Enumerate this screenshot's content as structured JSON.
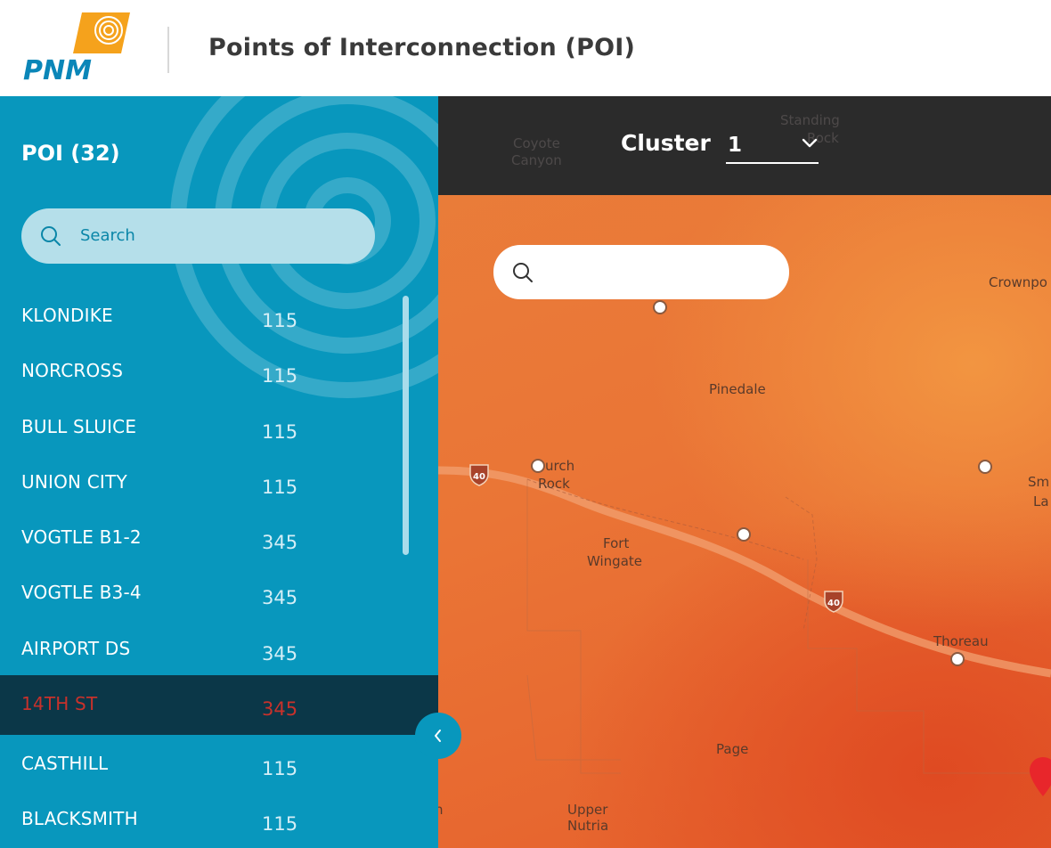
{
  "header": {
    "logo_text": "PNM",
    "title": "Points of Interconnection (POI)"
  },
  "sidebar": {
    "title": "POI (32)",
    "search_placeholder": "Search",
    "items": [
      {
        "name": "KLONDIKE",
        "kv": "115"
      },
      {
        "name": "NORCROSS",
        "kv": "115"
      },
      {
        "name": "BULL SLUICE",
        "kv": "115"
      },
      {
        "name": "UNION CITY",
        "kv": "115"
      },
      {
        "name": "VOGTLE B1-2",
        "kv": "345"
      },
      {
        "name": "VOGTLE B3-4",
        "kv": "345"
      },
      {
        "name": "AIRPORT DS",
        "kv": "345"
      },
      {
        "name": "14TH ST",
        "kv": "345",
        "active": true
      },
      {
        "name": "CASTHILL",
        "kv": "115"
      },
      {
        "name": "BLACKSMITH",
        "kv": "115"
      }
    ]
  },
  "map": {
    "cluster_label": "Cluster",
    "cluster_value": "1",
    "colors": {
      "accent": "#0897bd",
      "active_row": "#0b3748",
      "active_text": "#c8312b",
      "topbar": "#2b2b2b"
    },
    "places": {
      "standing": "Standing",
      "rock": "Rock",
      "coyote": "Coyote",
      "canyon": "Canyon",
      "crownpoint": "Crownpo",
      "pinedale": "Pinedale",
      "church": "urch",
      "church_rock": "Rock",
      "sm": "Sm",
      "la": "La",
      "fort": "Fort",
      "wingate": "Wingate",
      "thoreau": "Thoreau",
      "page": "Page",
      "upper": "Upper",
      "nutria": "Nutria",
      "n_edge": "n"
    },
    "interstate": "40"
  }
}
